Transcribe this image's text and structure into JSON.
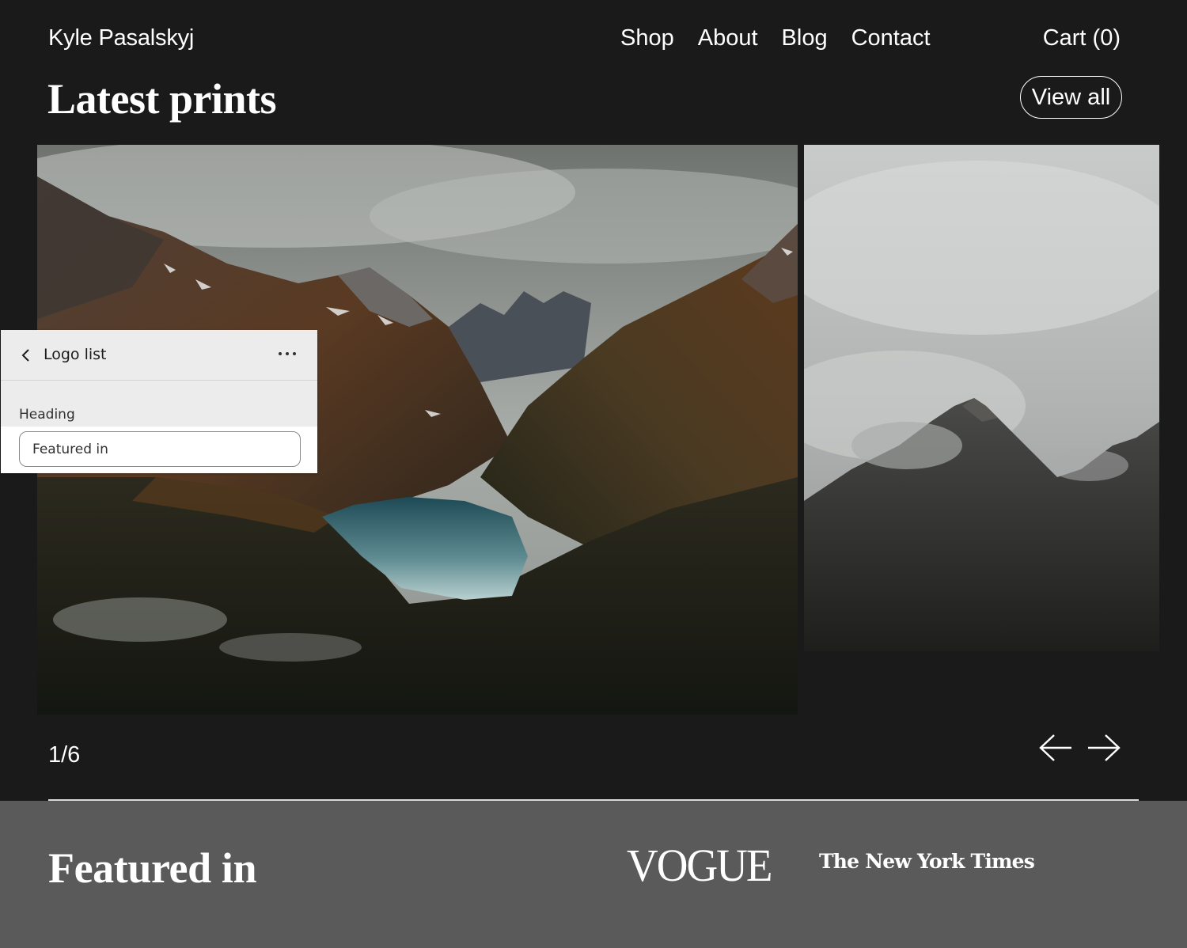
{
  "header": {
    "brand": "Kyle Pasalskyj",
    "nav": [
      "Shop",
      "About",
      "Blog",
      "Contact"
    ],
    "cart": "Cart (0)"
  },
  "prints": {
    "title": "Latest prints",
    "view_all": "View all",
    "counter": "1/6"
  },
  "featured": {
    "title": "Featured in",
    "logos": [
      "VOGUE",
      "The New York Times"
    ]
  },
  "editor_panel": {
    "title": "Logo list",
    "field_label": "Heading",
    "field_value": "Featured in"
  },
  "icons": {
    "back": "chevron-left-icon",
    "more": "more-horizontal-icon",
    "prev": "arrow-left-icon",
    "next": "arrow-right-icon"
  },
  "colors": {
    "page_bg": "#1b1a1b",
    "featured_bg": "#5b5a5b",
    "panel_bg": "#ececec",
    "text": "#ffffff"
  }
}
